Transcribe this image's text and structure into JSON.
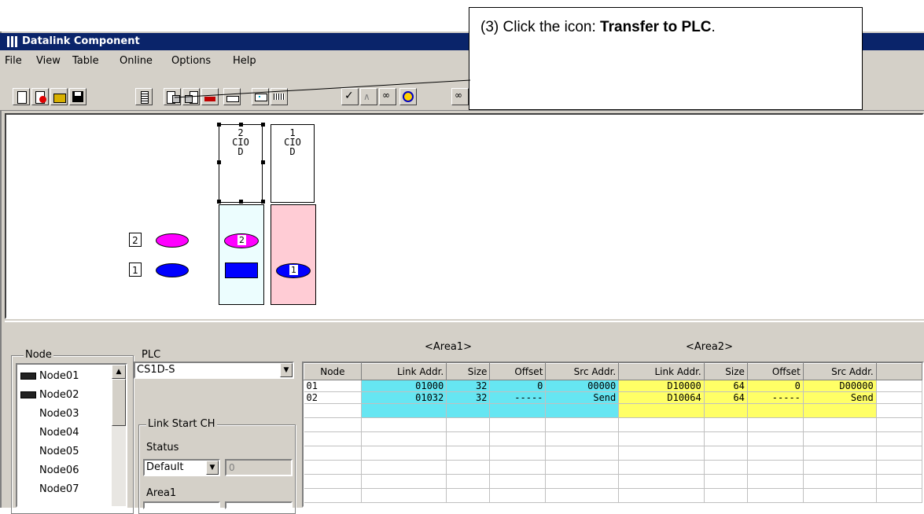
{
  "window": {
    "title": "Datalink Component"
  },
  "menu": [
    "File",
    "View",
    "Table",
    "Online",
    "Options",
    "Help"
  ],
  "toolbar_icons": [
    "new-file-icon",
    "delete-file-icon",
    "open-folder-icon",
    "save-disk-icon",
    "plc-icon",
    "transfer-to-plc-icon",
    "transfer-from-plc-icon",
    "compare-icon",
    "monitor-icon",
    "network-icon",
    "table-icon",
    "check-icon",
    "wave-icon",
    "link-icon",
    "status-icon",
    "chain-icon"
  ],
  "callout": {
    "prefix": "(3) Click the icon: ",
    "bold": "Transfer to PLC",
    "suffix": "."
  },
  "canvas": {
    "nodes": [
      {
        "num": "2",
        "type": "CIO",
        "letter": "D"
      },
      {
        "num": "1",
        "type": "CIO",
        "letter": "D"
      }
    ],
    "legend_items": [
      "2",
      "1"
    ],
    "node2_badge": "2",
    "node1_badge": "1",
    "colors": {
      "magenta": "#ff00ff",
      "blue": "#0000ff",
      "light_cyan": "#ecfdfe",
      "pink": "#ffccd5"
    }
  },
  "node_panel": {
    "legend": "Node",
    "items": [
      {
        "label": "Node01",
        "icon": true
      },
      {
        "label": "Node02",
        "icon": true,
        "selected": true
      },
      {
        "label": "Node03",
        "icon": false
      },
      {
        "label": "Node04",
        "icon": false
      },
      {
        "label": "Node05",
        "icon": false
      },
      {
        "label": "Node06",
        "icon": false
      },
      {
        "label": "Node07",
        "icon": false
      }
    ]
  },
  "plc_panel": {
    "label": "PLC",
    "plc_model": "CS1D-S",
    "link_start_legend": "Link Start CH",
    "status_label": "Status",
    "status_value": "Default",
    "status_input": "0",
    "area1_label": "Area1"
  },
  "grid": {
    "area1_title": "<Area1>",
    "area2_title": "<Area2>",
    "headers": [
      "Node",
      "Link Addr.",
      "Size",
      "Offset",
      "Src Addr.",
      "Link Addr.",
      "Size",
      "Offset",
      "Src Addr."
    ],
    "rows": [
      [
        "01",
        "01000",
        "32",
        "0",
        "00000",
        "D10000",
        "64",
        "0",
        "D00000"
      ],
      [
        "02",
        "01032",
        "32",
        "-----",
        "Send",
        "D10064",
        "64",
        "-----",
        "Send"
      ]
    ]
  }
}
